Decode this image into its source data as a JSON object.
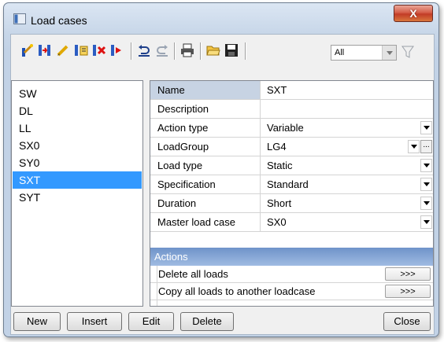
{
  "window": {
    "title": "Load cases",
    "close_label": "X"
  },
  "toolbar": {
    "icons": [
      "new-load-case-icon",
      "insert-icon",
      "edit-icon",
      "copy-icon",
      "delete-icon",
      "move-icon",
      "undo-icon",
      "redo-icon",
      "print-icon",
      "open-icon",
      "save-icon"
    ],
    "filter_value": "All"
  },
  "load_cases": [
    "SW",
    "DL",
    "LL",
    "SX0",
    "SY0",
    "SXT",
    "SYT"
  ],
  "selected_case": "SXT",
  "properties": {
    "header_name": "Name",
    "header_value": "SXT",
    "rows": [
      {
        "name": "Description",
        "value": ""
      },
      {
        "name": "Action type",
        "value": "Variable"
      },
      {
        "name": "LoadGroup",
        "value": "LG4"
      },
      {
        "name": "Load type",
        "value": "Static"
      },
      {
        "name": "Specification",
        "value": "Standard"
      },
      {
        "name": "Duration",
        "value": "Short"
      },
      {
        "name": "Master load case",
        "value": "SX0"
      }
    ],
    "ellipsis_label": "..."
  },
  "actions": {
    "title": "Actions",
    "items": [
      {
        "label": "Delete all loads",
        "button": ">>>"
      },
      {
        "label": "Copy all loads to another loadcase",
        "button": ">>>"
      }
    ]
  },
  "buttons": {
    "new": "New",
    "insert": "Insert",
    "edit": "Edit",
    "delete": "Delete",
    "close": "Close"
  },
  "colors": {
    "selection": "#3399ff",
    "actions_header": "#7f9fd1",
    "close_button": "#c9452f"
  }
}
